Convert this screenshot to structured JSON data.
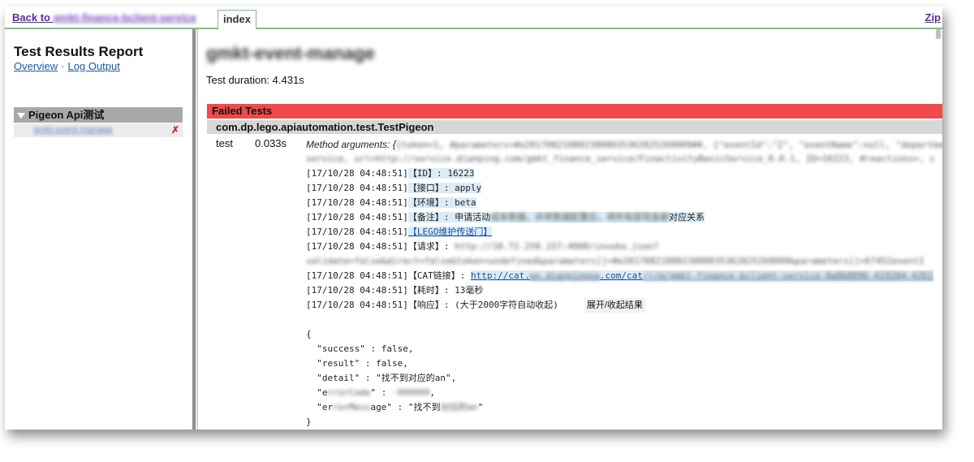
{
  "topbar": {
    "back_prefix": "Back to ",
    "back_target": "gmkt-finance-bclient-service",
    "tab_index": "index",
    "zip": "Zip"
  },
  "sidebar": {
    "title": "Test Results Report",
    "link_overview": "Overview",
    "link_sep": "·",
    "link_log": "Log Output",
    "group_label": "Pigeon Api测试",
    "item_label": "gmkt-event-manage",
    "item_status": "✗"
  },
  "main": {
    "title": "gmkt-event-manage",
    "duration": "Test duration: 4.431s",
    "failed_header": "Failed Tests",
    "class_name": "com.dp.lego.apiautomation.test.TestPigeon",
    "test_name": "test",
    "test_time": "0.033s",
    "method_label": "Method arguments: {",
    "method_args_1": "{token=1, #parameters=#e2017082100023000035362825260009##, {\"eventId\":\"2\", \"eventName\":null, \"department",
    "method_args_2": "service, url=http://service.dianping.com/gmkt_finance_service/FinactivityBasicService_0.0.1, ID=16223, #reactions=, c",
    "log_prefix": "[17/10/28 04:48:51]",
    "log_id": "【ID】: 16223",
    "log_api": "【接口】: apply",
    "log_env": "【环境】: beta",
    "log_note_a": "【备注】: 申请活动",
    "log_note_blur": "成本数据，并将数据配置后，将所有提现金额",
    "log_note_b": "对应关系",
    "log_lego": "【LEGO维护传送门】",
    "log_req": "【请求】: ",
    "log_req_blur": "http://10.72.250.157:4080/invoke.json?",
    "log_req_blur2": "validate=false&direct=false&token=undefined&parameters[]=#e2017082100023000035362825260009&parameters[]=67452eventI",
    "log_cat_label": "【CAT链接】: ",
    "log_cat_url_a": "http://cat.",
    "log_cat_url_blur1": "ws.dianpingoa",
    "log_cat_url_b": ".com/cat",
    "log_cat_url_blur2": "/r/m/gmkt-finance-bclient-service-0a0b8096-419204-4261",
    "log_time": "【耗时】: 13毫秒",
    "log_resp": "【响应】: (大于2000字符自动收起)",
    "toggle": "展开/收起结果",
    "json_open": "{",
    "json_success": "  \"success\" : false,",
    "json_result": "  \"result\" : false,",
    "json_detail": "  \"detail\" : \"找不到对应的an\",",
    "json_err_code_a": "  \"e",
    "json_err_code_blur": "rrorCode",
    "json_err_code_b": "\" : ",
    "json_err_code_val": "-999999",
    "json_err_code_c": ",",
    "json_err_msg_a": "  \"er",
    "json_err_msg_blur": "rorMess",
    "json_err_msg_b": "age\" : \"找不到",
    "json_err_msg_val": "对应的an",
    "json_err_msg_c": "\"",
    "json_close": "}"
  },
  "colors": {
    "failed_header": "#f04a4a",
    "class_header": "#d6d6d6",
    "tab_border": "#7ac47a",
    "link": "#1a4fa0"
  }
}
